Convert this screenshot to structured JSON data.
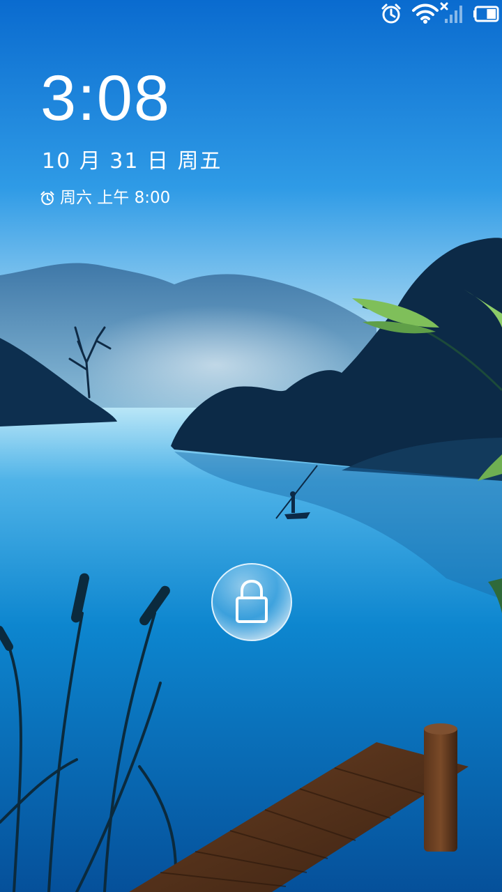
{
  "status_bar": {
    "icons": [
      "alarm-icon",
      "wifi-icon",
      "no-signal-icon",
      "battery-icon"
    ],
    "battery_level": 0.45
  },
  "lockscreen": {
    "time": "3:08",
    "date": "10 月 31 日 周五",
    "next_alarm": "周六 上午 8:00",
    "unlock_icon": "lock-icon"
  },
  "colors": {
    "sky_top": "#0a6fd1",
    "sky_horizon": "#e8f4f6",
    "lake": "#0b7fc9",
    "text": "#ffffff"
  }
}
